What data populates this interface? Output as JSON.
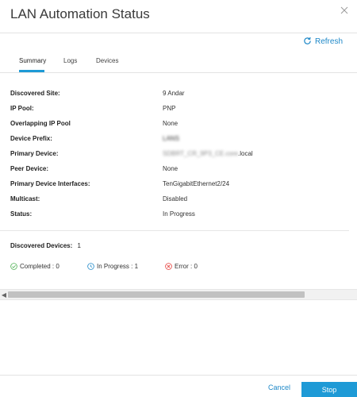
{
  "dialog": {
    "title": "LAN Automation Status",
    "close_icon": "close-icon"
  },
  "toolbar": {
    "refresh_label": "Refresh",
    "refresh_icon": "refresh-icon"
  },
  "tabs": [
    {
      "label": "Summary",
      "active": true
    },
    {
      "label": "Logs",
      "active": false
    },
    {
      "label": "Devices",
      "active": false
    }
  ],
  "summary": {
    "rows": [
      {
        "label": "Discovered Site:",
        "value": "9 Andar"
      },
      {
        "label": "IP Pool:",
        "value": "PNP"
      },
      {
        "label": "Overlapping IP Pool",
        "value": "None"
      },
      {
        "label": "Device Prefix:",
        "value": "LANS"
      },
      {
        "label": "Primary Device:",
        "value": "SDBRT_CR_9P3_CE.core",
        "suffix": ".local"
      },
      {
        "label": "Peer Device:",
        "value": "None"
      },
      {
        "label": "Primary Device Interfaces:",
        "value": "TenGigabitEthernet2/24"
      },
      {
        "label": "Multicast:",
        "value": "Disabled"
      },
      {
        "label": "Status:",
        "value": "In Progress"
      }
    ]
  },
  "discovered": {
    "label": "Discovered Devices:",
    "count": "1",
    "statuses": [
      {
        "label": "Completed : 0",
        "icon": "check-circle-icon",
        "color": "#4caf50"
      },
      {
        "label": "In Progress : 1",
        "icon": "clock-icon",
        "color": "#1e88c8"
      },
      {
        "label": "Error : 0",
        "icon": "error-circle-icon",
        "color": "#e53935"
      }
    ]
  },
  "footer": {
    "cancel_label": "Cancel",
    "stop_label": "Stop"
  },
  "colors": {
    "accent": "#1e9ad6",
    "link": "#1e88c8"
  }
}
